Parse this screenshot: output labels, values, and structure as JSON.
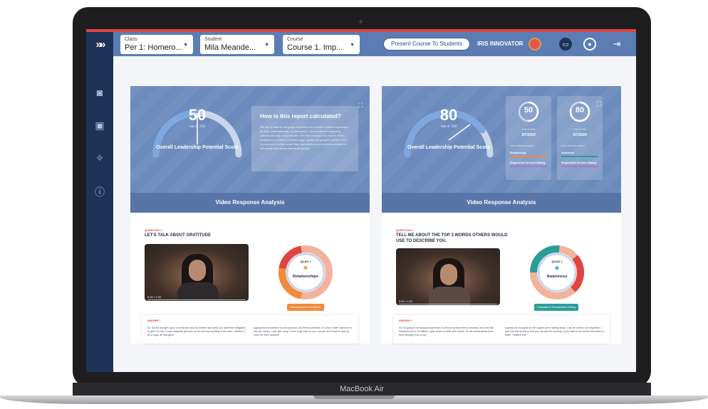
{
  "device": {
    "label": "MacBook Air"
  },
  "header": {
    "selectors": [
      {
        "label": "Class",
        "value": "Per 1: Homero..."
      },
      {
        "label": "Student",
        "value": "Mila Meande..."
      },
      {
        "label": "Course",
        "value": "Course 1. Imp..."
      }
    ],
    "present_button": "Present Course To Students",
    "user_name": "IRIS INNOVATOR"
  },
  "sidebar": {
    "icons": [
      "camera-icon",
      "student-card-icon",
      "sparkle-icon",
      "help-icon"
    ]
  },
  "left_panel": {
    "score": "50",
    "out_of": "out of 100",
    "score_title": "Overall Leadership Potential Score",
    "info_title": "How is this report calculated?",
    "info_text": "We use a Natural Language Processor to evaluate student responses for their understanding, demonstration, and sentiment regarding various soft skill competencies. We then compare the results of this analysis to a number of factors (age, grade, geographic context, etc.) to produce a holistic score that represents each student's potential to effectively lead teams and small groups.",
    "section_title": "Video Response Analysis",
    "question_label": "QUESTION 1",
    "question_text": "LET'S TALK ABOUT GRATITUDE",
    "video_time": "0:00 / 1:33",
    "quad_label": "QUAD 1",
    "quad_name": "Relationships",
    "pill": "Compassion & Gratitude",
    "answer_label": "ANSWER 1",
    "answer_left": "So. So the last gift I gave to someone was my brother last week, so I didn't feel obligated to give it to him. It was notepads gift card, so he can buy anything in the store, whether it be a bugs, all that game",
    "answer_right": "saying that his furniture is not important, but there's priorities. So since I didn't want her to use her money, I was like, okay, I have a gift card for you, but you don't have to ask my mom for more because"
  },
  "right_panel": {
    "score": "80",
    "out_of": "out of 100",
    "score_title": "Overall Leadership Potential Score",
    "mini_cards": [
      {
        "score": "50",
        "out_of": "Out of 100",
        "date": "3/7/2024",
        "head": "TOP STRENGTH AREAS",
        "items": [
          "Relationships",
          "Responsible Decision Making"
        ]
      },
      {
        "score": "80",
        "out_of": "Out of 100",
        "date": "3/7/2024",
        "head": "LET'S GROWTH AREAS",
        "items": [
          "Awareness",
          "Responsible Decision Making"
        ]
      }
    ],
    "section_title": "Video Response Analysis",
    "question_label": "QUESTION 1",
    "question_text": "TELL ME ABOUT THE TOP 3 WORDS OTHERS WOULD USE TO DESCRIBE YOU.",
    "video_time": "0:00 / 1:24",
    "quad_label": "QUAD 1",
    "quad_name": "Awareness",
    "pill": "Curiosity & Perspective-Taking",
    "answer_label": "ANSWER 1",
    "answer_left": "So I'm going to be basing myself from my friend my best friend. Amanda, who she has described me to be faithful, loyal, down to earth and honest. So me and Amanda have been through a lot of ups",
    "answer_right": "express my thoughts on the subject we're talking about. I will be honest, but respectful. I won't be the honest to hurt you. It's just the honesty of you have to be honest and down to earth. I believe she"
  },
  "colors": {
    "accent_red": "#e0443f",
    "topbar_blue": "#5b7db4",
    "sidebar_navy": "#1d3358",
    "relationships_orange": "#f28a3c",
    "awareness_teal": "#2a9d98"
  }
}
